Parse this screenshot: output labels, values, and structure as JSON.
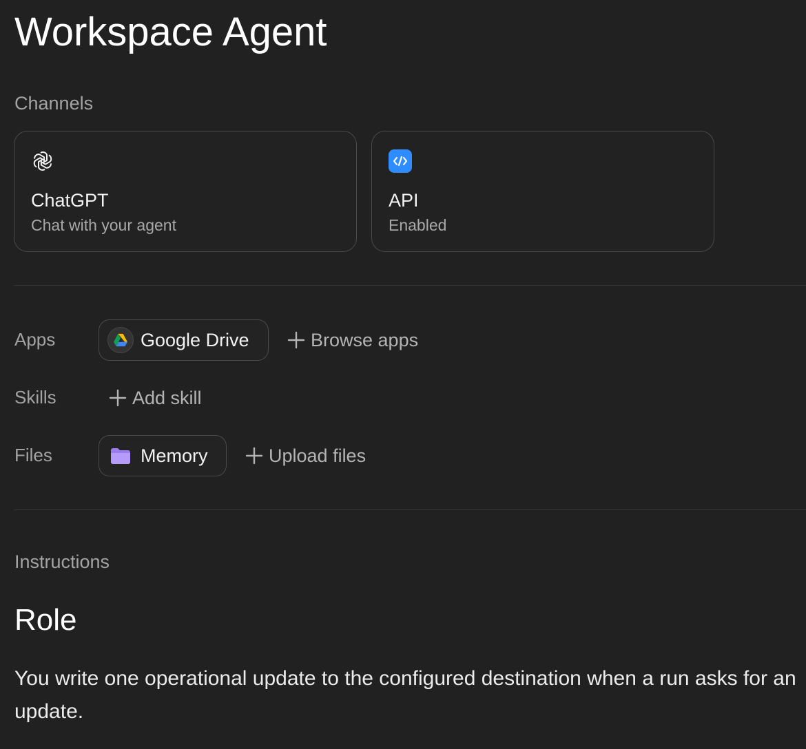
{
  "page_title": "Workspace Agent",
  "channels": {
    "label": "Channels",
    "items": [
      {
        "title": "ChatGPT",
        "subtitle": "Chat with your agent",
        "icon": "openai-logo-icon"
      },
      {
        "title": "API",
        "subtitle": "Enabled",
        "icon": "code-icon"
      }
    ]
  },
  "apps": {
    "label": "Apps",
    "items": [
      {
        "name": "Google Drive",
        "icon": "google-drive-icon"
      }
    ],
    "browse_label": "Browse apps"
  },
  "skills": {
    "label": "Skills",
    "add_label": "Add skill"
  },
  "files": {
    "label": "Files",
    "items": [
      {
        "name": "Memory",
        "icon": "folder-icon"
      }
    ],
    "upload_label": "Upload files"
  },
  "instructions": {
    "label": "Instructions",
    "heading": "Role",
    "body": "You write one operational update to the configured destination when a run asks for an update."
  },
  "colors": {
    "background": "#212121",
    "border": "#4a4a4a",
    "api_icon_bg": "#2f8cff",
    "folder": "#a98bf5",
    "muted_text": "#a3a3a3"
  }
}
